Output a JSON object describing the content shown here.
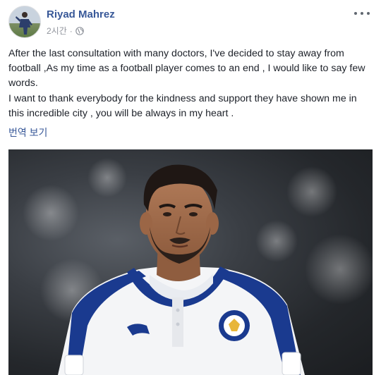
{
  "post": {
    "author": "Riyad Mahrez",
    "time": "2시간",
    "separator": "·",
    "privacy_icon": "globe-icon",
    "more_icon": "more-horizontal-icon",
    "paragraphs": [
      "After the last consultation with many doctors, I've decided to stay away from football ,As my time as a football player comes to an end , I would like to say few words.",
      "I want to thank everybody for the kindness and support they have shown me in this incredible city , you will be always in my heart ."
    ],
    "translate_label": "번역 보기"
  },
  "colors": {
    "link": "#385898",
    "meta": "#90949c",
    "text": "#1d2129",
    "kit_blue": "#1a3a8f"
  }
}
